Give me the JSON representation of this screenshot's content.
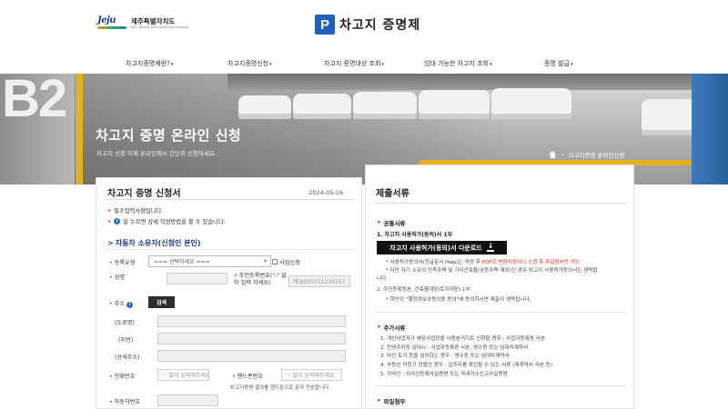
{
  "header": {
    "logo_word": "Jeju",
    "logo_ko": "제주특별자치도",
    "logo_en": "Jeju Special Self-Governing Province",
    "brand_mark": "P",
    "brand_title": "차고지 증명제"
  },
  "nav": {
    "items": [
      {
        "label": "차고지증명제란?"
      },
      {
        "label": "차고지증명신청"
      },
      {
        "label": "차고지 증명대상 조회"
      },
      {
        "label": "임대 가능한 차고지 조회"
      },
      {
        "label": "증명 발급"
      }
    ]
  },
  "hero": {
    "pillar_text": "B2",
    "title": "차고지 증명 온라인 신청",
    "subtitle": "차고지 신청 이제 온라인에서 간단히 신청하세요.",
    "breadcrumb_current": "차고지증명 온라인신청"
  },
  "form": {
    "title": "차고지 증명 신청서",
    "date": "2024-05-16",
    "note_required": "필수입력사항입니다.",
    "note_info": "을 누르면 상세 작성방법을 볼 수 있습니다.",
    "section_title": "자동차 소유자(신청인 본인)",
    "fields": {
      "reg_type_label": "등록유형",
      "reg_type_value": "=== 선택하세요 ===",
      "business_label": "사업신청",
      "name_label": "성명",
      "rrn_label": "주민등록번호(\"-\" 없이 입력 하세요)",
      "rrn_placeholder": "예)8005011234567",
      "address_label": "주소",
      "search_button": "검색",
      "road_label": "(도로명)",
      "lot_label": "(지번)",
      "detail_label": "(상세주소)",
      "phone_label": "전화번호",
      "phone_placeholder": "'-' 없이 입력해주세요",
      "mobile_label": "핸드폰번호",
      "mobile_placeholder": "'-' 없이 입력해주세요",
      "mobile_note": "차고지증명 결과를 핸드폰으로 문자 전송합니다.",
      "car_number_label": "자동차번호"
    }
  },
  "docs": {
    "title": "제출서류",
    "common_heading": "공통서류",
    "item1_title": "1. 차고지 사용허가(동의)서 1부",
    "download_button": "차고지 사용허가(동의)서 다운로드",
    "item1_note_a": "* 사용허가동의서(한글문서.Hwp)는 작성 후 ",
    "item1_note_red": "PDF로 변환저장이나 스캔 후 파일첨부만 가능",
    "item1_note_b": "* 다만 자기 소유의 단독주택 및 기타건축물(공동주택 제외)인 경우 차고지 사용허가동의서는 생략합",
    "item1_note_c": "니다.",
    "item2_title": "2. 주민등록등본, 건축물대장(토지대장) 1부.",
    "item2_note": "* 하단의 \"행정정보공동이용 동의\"에 동의하시면 제출이 생략됩니다.",
    "extra_heading": "추가서류",
    "extra_items": [
      "1. 개인사업자가 해당사업장을 사용본거지로 신청할 경우 : 사업자등록증 사본",
      "2. 민영주차장 임대시 : 사업자등록증 사본, 영수증 또는 임대차계약서",
      "3. 타인 토지 등을 임차하는 경우 : 영수증 또는 임대차계약서",
      "4. 부동산 미등기 건물인 경우 : 입주자를 확인할 수 있는 서류 (재계약서 사본 등)",
      "5. 외국인 : 외국인등록사실증명 또는 국내거소신고사실증명"
    ],
    "attach_heading": "파일첨부"
  }
}
